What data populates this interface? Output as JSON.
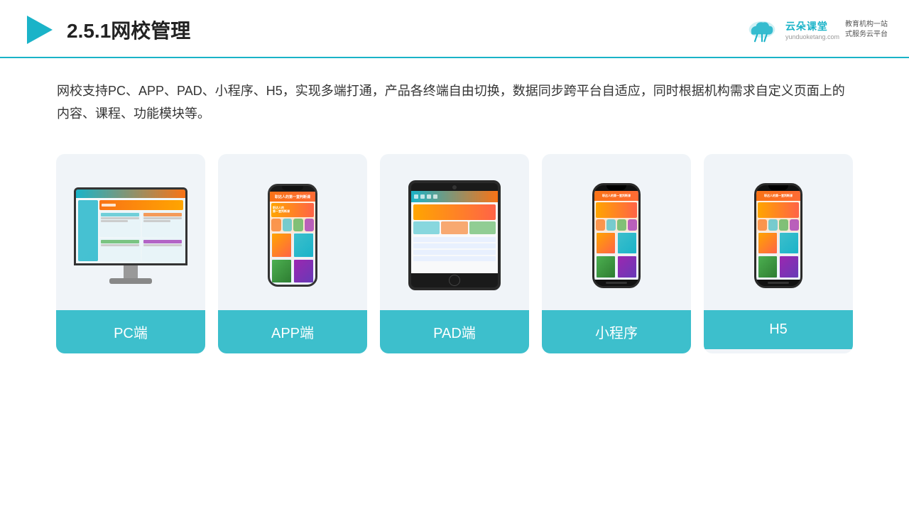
{
  "header": {
    "title": "2.5.1网校管理",
    "logo_name": "云朵课堂",
    "logo_url": "yunduoketang.com",
    "logo_slogan": "教育机构一站\n式服务云平台"
  },
  "description": {
    "text": "网校支持PC、APP、PAD、小程序、H5，实现多端打通，产品各终端自由切换，数据同步跨平台自适应，同时根据机构需求自定义页面上的内容、课程、功能模块等。"
  },
  "cards": [
    {
      "id": "pc",
      "label": "PC端"
    },
    {
      "id": "app",
      "label": "APP端"
    },
    {
      "id": "pad",
      "label": "PAD端"
    },
    {
      "id": "miniprogram",
      "label": "小程序"
    },
    {
      "id": "h5",
      "label": "H5"
    }
  ]
}
